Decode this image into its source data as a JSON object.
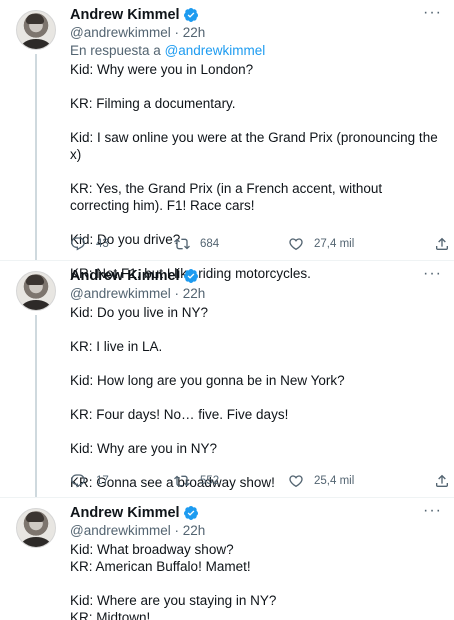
{
  "tweets": [
    {
      "display_name": "Andrew Kimmel",
      "handle": "@andrewkimmel",
      "time": "· 22h",
      "reply_prefix": "En respuesta a",
      "reply_mention": "@andrewkimmel",
      "lines": [
        "Kid: Why were you in London?",
        "",
        "KR: Filming a documentary.",
        "",
        "Kid: I saw online you were at the Grand Prix (pronouncing the x)",
        "",
        "KR: Yes, the Grand Prix (in a French accent, without correcting him). F1! Race cars!",
        "",
        "Kid: Do you drive?",
        "",
        "KR: Not F1, but I like riding motorcycles."
      ],
      "replies": "43",
      "retweets": "684",
      "likes": "27,4 mil"
    },
    {
      "display_name": "Andrew Kimmel",
      "handle": "@andrewkimmel",
      "time": "· 22h",
      "lines": [
        "Kid: Do you live in NY?",
        "",
        "KR: I live in LA.",
        "",
        "Kid: How long are you gonna be in New York?",
        "",
        "KR: Four days! No… five. Five days!",
        "",
        "Kid: Why are you in NY?",
        "",
        "KR: Gonna see a broadway show!"
      ],
      "replies": "17",
      "retweets": "552",
      "likes": "25,4 mil"
    },
    {
      "display_name": "Andrew Kimmel",
      "handle": "@andrewkimmel",
      "time": "· 22h",
      "lines": [
        "Kid: What broadway show?",
        "KR: American Buffalo! Mamet!",
        "",
        "Kid: Where are you staying in NY?",
        "KR: Midtown!"
      ]
    }
  ],
  "icons": {
    "verified": "verified-badge-icon",
    "more": "more-options-icon",
    "reply": "reply-icon",
    "retweet": "retweet-icon",
    "like": "like-icon",
    "share": "share-icon"
  },
  "colors": {
    "accent": "#1d9bf0",
    "secondary_text": "#536471",
    "primary_text": "#0f1419",
    "thread_line": "#cfd9de"
  }
}
